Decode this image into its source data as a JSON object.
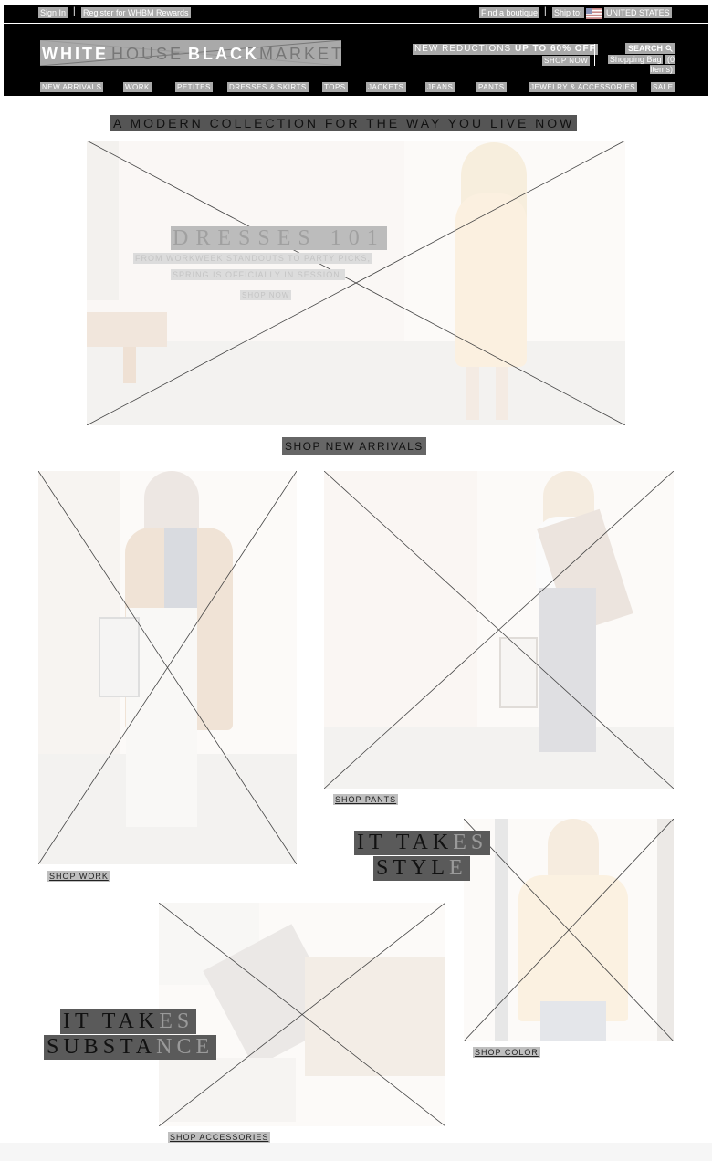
{
  "utility": {
    "sign_in": "Sign In",
    "register": "Register for WHBM Rewards",
    "find_boutique": "Find a boutique",
    "ship_to_label": "Ship to:",
    "country": "UNITED STATES",
    "separator": "|"
  },
  "header": {
    "logo": {
      "left": "WHITE",
      "middle": "HOUSE",
      "right_bold": "BLACK",
      "right": "MARKET"
    },
    "promo_lead": "NEW REDUCTIONS ",
    "promo_bold": "UP TO 60% OFF",
    "promo_cta": "SHOP NOW",
    "search_label": "SEARCH",
    "bag_label": "Shopping Bag",
    "bag_count": "(0 Items)"
  },
  "nav": [
    {
      "label": "New Arrivals"
    },
    {
      "label": "Work"
    },
    {
      "label": "Petites"
    },
    {
      "label": "Dresses & Skirts"
    },
    {
      "label": "Tops"
    },
    {
      "label": "Jackets"
    },
    {
      "label": "Jeans"
    },
    {
      "label": "Pants"
    },
    {
      "label": "Jewelry & Accessories"
    },
    {
      "label": "Sale"
    }
  ],
  "hero": {
    "tagline": "A MODERN COLLECTION FOR THE WAY YOU LIVE NOW",
    "title": "DRESSES 101",
    "sub1": "FROM WORKWEEK STANDOUTS TO PARTY PICKS,",
    "sub2": "SPRING IS OFFICIALLY IN SESSION.",
    "cta": "SHOP NOW"
  },
  "shop_new_arrivals": "SHOP NEW ARRIVALS",
  "tiles": {
    "work": "SHOP WORK",
    "pants": "SHOP PANTS",
    "color": "SHOP COLOR",
    "accessories": "SHOP ACCESSORIES"
  },
  "promos": {
    "style_line1_a": "IT TAK",
    "style_line1_b": "ES",
    "style_line2_a": "STYL",
    "style_line2_b": "E",
    "substance_line1_a": "IT TAK",
    "substance_line1_b": "ES",
    "substance_line2_a": "SUBSTA",
    "substance_line2_b": "NCE"
  },
  "colors": {
    "header_bg": "#000000",
    "text_highlight": "#a9a9a9",
    "dark_highlight": "#555555"
  },
  "icons": [
    "search-icon",
    "us-flag-icon",
    "broken-image-icon"
  ]
}
